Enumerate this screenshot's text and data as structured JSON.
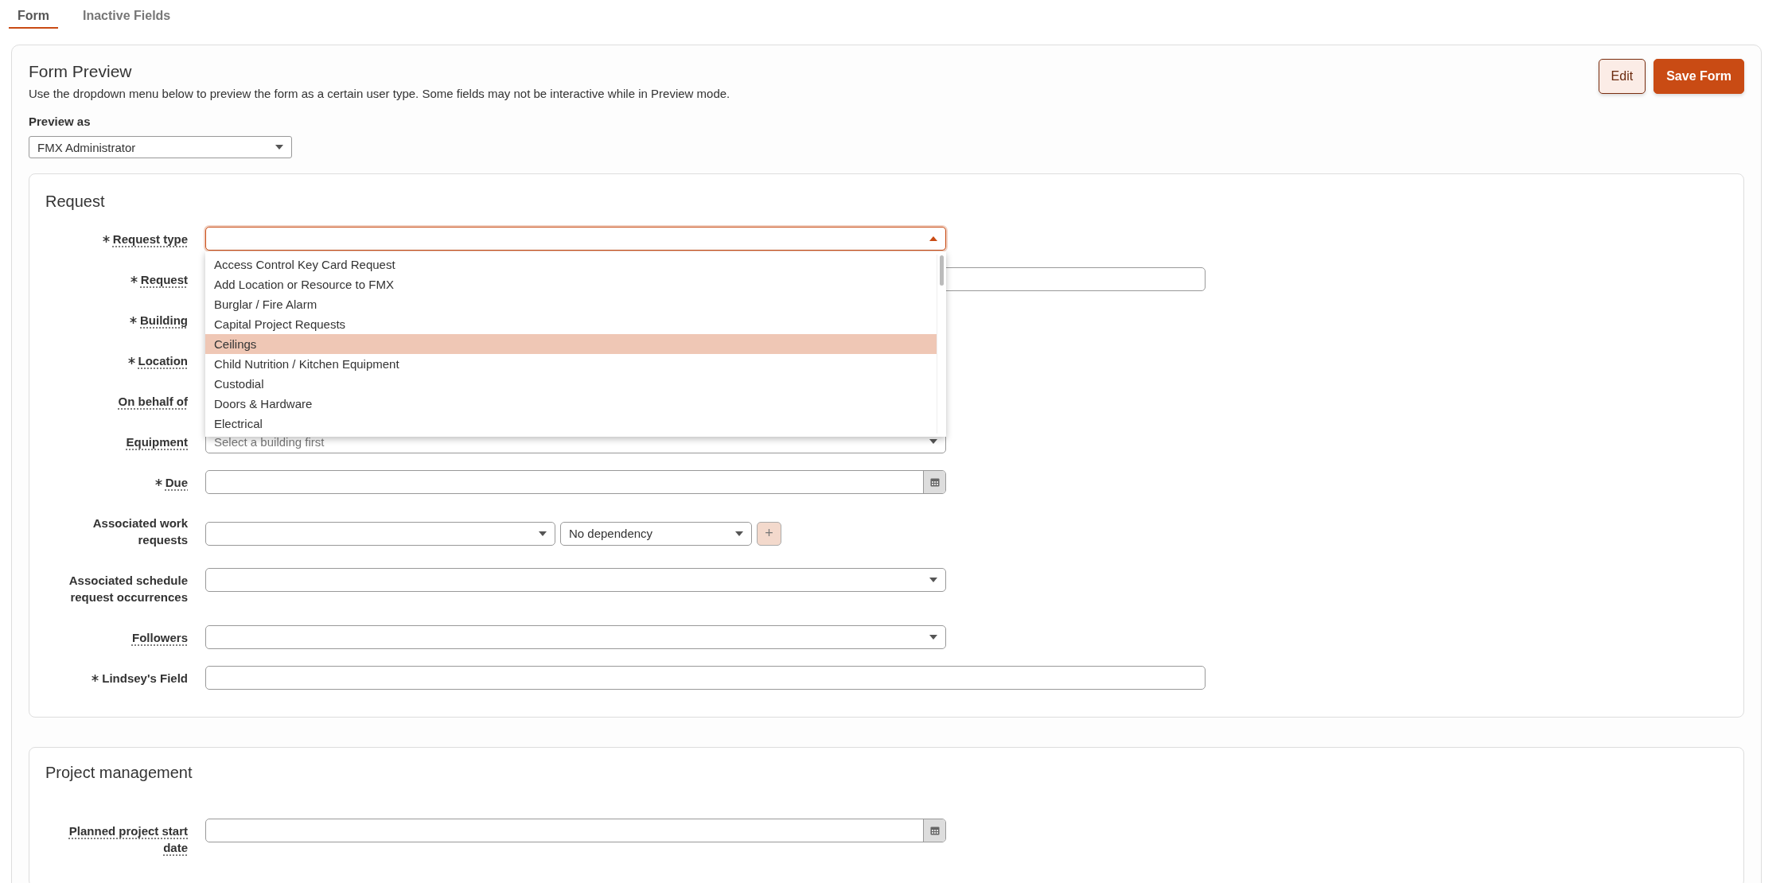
{
  "tabs": [
    {
      "label": "Form",
      "selected": true
    },
    {
      "label": "Inactive Fields",
      "selected": false
    }
  ],
  "preview": {
    "title": "Form Preview",
    "description": "Use the dropdown menu below to preview the form as a certain user type. Some fields may not be interactive while in Preview mode.",
    "buttons": [
      {
        "label": "Edit",
        "kind": "secondary"
      },
      {
        "label": "Save Form",
        "kind": "primary"
      }
    ],
    "preview_as": {
      "label": "Preview as",
      "value": "FMX Administrator"
    }
  },
  "sections": [
    {
      "title": "Request",
      "fields": [
        {
          "label": "Request type",
          "required": true,
          "has_help": true,
          "kind": "select",
          "wide": false,
          "focused": true,
          "expanded": true,
          "options": [
            {
              "label": "Access Control Key Card Request",
              "highlighted": false
            },
            {
              "label": "Add Location or Resource to FMX",
              "highlighted": false
            },
            {
              "label": "Burglar / Fire Alarm",
              "highlighted": false
            },
            {
              "label": "Capital Project Requests",
              "highlighted": false
            },
            {
              "label": "Ceilings",
              "highlighted": true
            },
            {
              "label": "Child Nutrition / Kitchen Equipment",
              "highlighted": false
            },
            {
              "label": "Custodial",
              "highlighted": false
            },
            {
              "label": "Doors & Hardware",
              "highlighted": false
            },
            {
              "label": "Electrical",
              "highlighted": false
            }
          ]
        },
        {
          "label": "Request",
          "required": true,
          "has_help": true,
          "kind": "text",
          "wide": true,
          "focused": false
        },
        {
          "label": "Building",
          "required": true,
          "has_help": true,
          "kind": "covered"
        },
        {
          "label": "Location",
          "required": true,
          "has_help": true,
          "kind": "covered"
        },
        {
          "label": "On behalf of",
          "required": false,
          "has_help": true,
          "kind": "covered"
        },
        {
          "label": "Equipment",
          "required": false,
          "has_help": true,
          "kind": "select",
          "wide": false,
          "focused": false,
          "expanded": false,
          "placeholder": "Select a building first"
        },
        {
          "label": "Due",
          "required": true,
          "has_help": true,
          "kind": "date",
          "wide": false
        },
        {
          "label": "Associated work requests",
          "required": false,
          "has_help": false,
          "kind": "work_requests",
          "dependency": "No dependency",
          "add": "+"
        },
        {
          "label": "Associated schedule request occurrences",
          "required": false,
          "has_help": false,
          "kind": "select",
          "wide": false,
          "focused": false,
          "expanded": false
        },
        {
          "label": "Followers",
          "required": false,
          "has_help": true,
          "kind": "select",
          "wide": false,
          "focused": false,
          "expanded": false
        },
        {
          "label": "Lindsey's Field",
          "required": true,
          "has_help": false,
          "kind": "text",
          "wide": true,
          "focused": false
        }
      ]
    },
    {
      "title": "Project management",
      "fields": [
        {
          "label": "Planned project start date",
          "required": false,
          "has_help": true,
          "kind": "date",
          "wide": false
        }
      ]
    }
  ]
}
